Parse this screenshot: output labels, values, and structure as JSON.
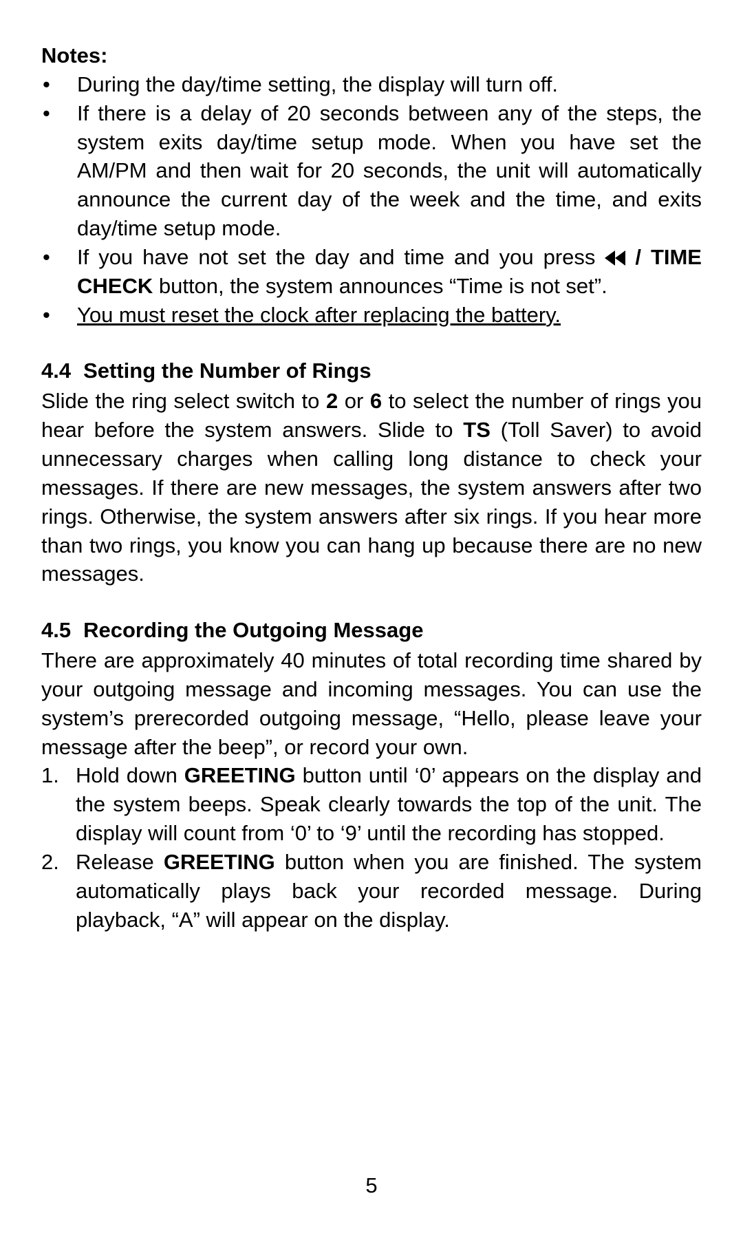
{
  "notes_heading": "Notes:",
  "notes": [
    {
      "b1": "During the day/time setting, the display will turn off."
    },
    {
      "b2": "If there is a delay of 20 seconds between any of the steps, the system exits day/time setup mode. When you have set the AM/PM and then wait for 20 seconds, the unit will automatically announce the current day of the week and the time, and exits day/time setup mode."
    },
    {
      "b3a": "If you have not set the day and time and you press ",
      "b3_slash_after_icon": " / ",
      "b3_time_check": "TIME CHECK",
      "b3b": " button, the system announces “Time is not set”."
    },
    {
      "b4": "You must reset the clock after replacing the battery."
    }
  ],
  "sec44": {
    "num": "4.4",
    "title": "Setting the Number of Rings",
    "p": {
      "t1": "Slide the ring select switch to ",
      "b2": "2",
      "t2": " or ",
      "b6": "6",
      "t3": " to select the number of rings you hear before the system answers. Slide to ",
      "bts": "TS",
      "t4": " (Toll Saver) to avoid unnecessary charges when calling long distance to check your messages. If there are new messages, the system answers after two rings. Otherwise, the system answers after six rings. If you hear more than two rings, you know you can hang up because there are no new messages."
    }
  },
  "sec45": {
    "num": "4.5",
    "title": "Recording the Outgoing Message",
    "intro": "There are approximately 40 minutes of total recording time shared by your outgoing message and incoming messages. You can use the system’s prerecorded outgoing message, “Hello, please leave your message after the beep”, or record your own.",
    "steps": [
      {
        "n": "1.",
        "t1": "Hold down ",
        "bg": "GREETING",
        "t2": " button until ‘0’ appears on the display and the system beeps. Speak clearly towards the top of the unit. The display will count from ‘0’ to ‘9’ until the recording has stopped."
      },
      {
        "n": "2.",
        "t1": "Release ",
        "bg": "GREETING",
        "t2": " button when you are finished. The system automatically plays back your recorded message. During playback, “A” will appear on the display."
      }
    ]
  },
  "page_number": "5"
}
